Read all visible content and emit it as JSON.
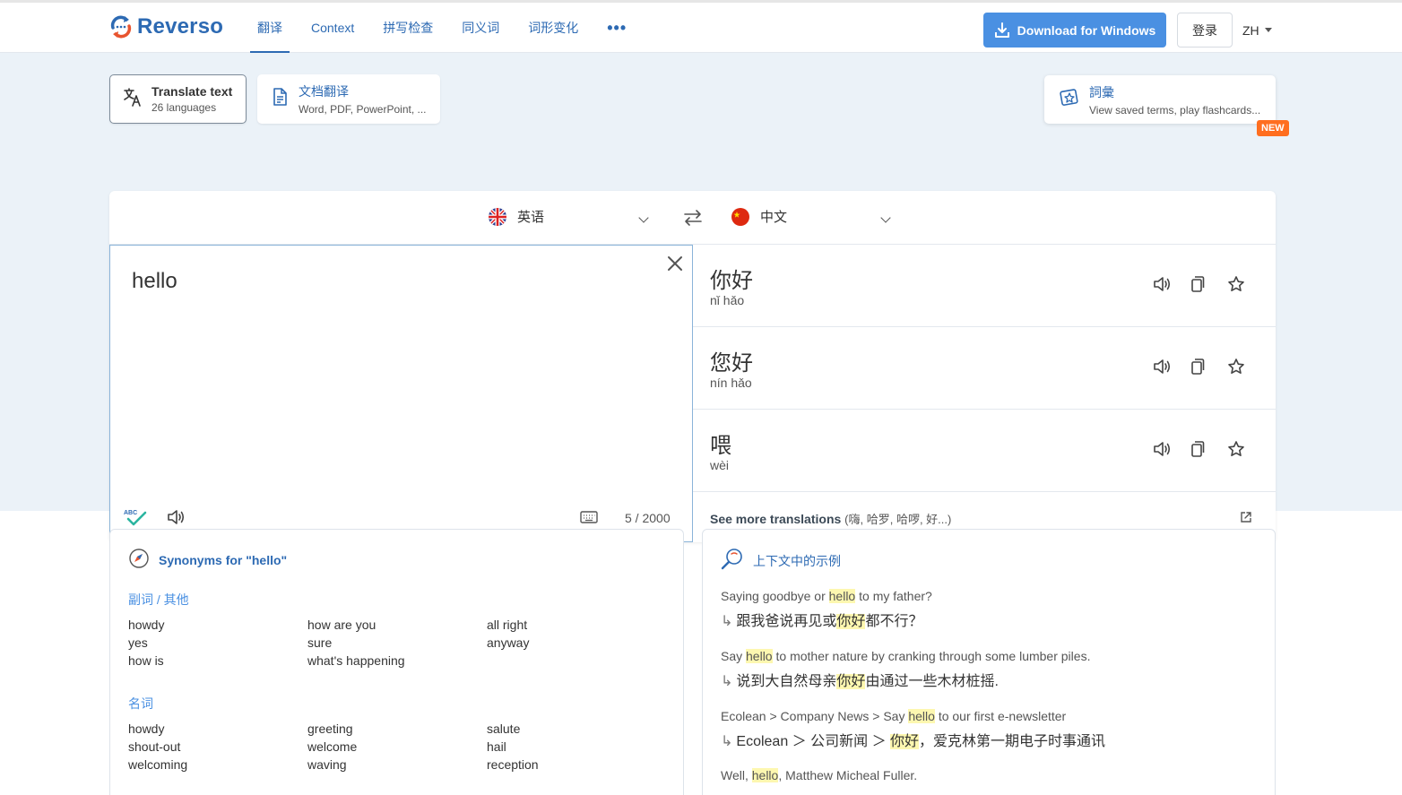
{
  "header": {
    "logo_text": "Reverso",
    "nav": [
      {
        "label": "翻译",
        "active": true
      },
      {
        "label": "Context"
      },
      {
        "label": "拼写检查"
      },
      {
        "label": "同义词"
      },
      {
        "label": "词形变化"
      },
      {
        "label": "•••"
      }
    ],
    "download_label": "Download for Windows",
    "login_label": "登录",
    "ui_lang": "ZH"
  },
  "modes": {
    "text": {
      "title": "Translate text",
      "subtitle": "26 languages"
    },
    "doc": {
      "title": "文档翻译",
      "subtitle": "Word, PDF, PowerPoint, ..."
    },
    "vocab": {
      "title": "詞彙",
      "subtitle": "View saved terms, play flashcards...",
      "badge": "NEW"
    }
  },
  "translator": {
    "source_lang": "英语",
    "target_lang": "中文",
    "source_text": "hello",
    "char_count": "5 / 2000",
    "results": [
      {
        "word": "你好",
        "pinyin": "nǐ hǎo"
      },
      {
        "word": "您好",
        "pinyin": "nín hǎo"
      },
      {
        "word": "喂",
        "pinyin": "wèi"
      }
    ],
    "see_more_label": "See more translations",
    "see_more_extra": "(嗨, 哈罗, 哈啰, 好...)"
  },
  "synonyms": {
    "title": "Synonyms for \"hello\"",
    "groups": [
      {
        "pos": "副词 / 其他",
        "words": [
          "howdy",
          "how are you",
          "all right",
          "yes",
          "sure",
          "anyway",
          "how is",
          "what's happening",
          ""
        ]
      },
      {
        "pos": "名词",
        "words": [
          "howdy",
          "greeting",
          "salute",
          "shout-out",
          "welcome",
          "hail",
          "welcoming",
          "waving",
          "reception"
        ]
      }
    ]
  },
  "context": {
    "title": "上下文中的示例",
    "examples": [
      {
        "en_pre": "Saying goodbye or ",
        "en_hl": "hello",
        "en_post": " to my father?",
        "zh_pre": "跟我爸说再见或",
        "zh_hl": "你好",
        "zh_post": "都不行？"
      },
      {
        "en_pre": "Say ",
        "en_hl": "hello",
        "en_post": " to mother nature by cranking through some lumber piles.",
        "zh_pre": "说到大自然母亲",
        "zh_hl": "你好",
        "zh_post": "由通过一些木材桩摇."
      },
      {
        "en_pre": "Ecolean > Company News > Say ",
        "en_hl": "hello",
        "en_post": " to our first e-newsletter",
        "zh_pre": "Ecolean ＞ 公司新闻 ＞ ",
        "zh_hl": "你好",
        "zh_post": "，爱克林第一期电子时事通讯"
      },
      {
        "en_pre": "Well, ",
        "en_hl": "hello",
        "en_post": ", Matthew Micheal Fuller.",
        "zh_pre": "",
        "zh_hl": "",
        "zh_post": ""
      }
    ]
  },
  "colors": {
    "brand": "#2d6ab3",
    "download": "#4a90e2",
    "badge": "#ff6e1f",
    "highlight": "#fdf7b0"
  }
}
